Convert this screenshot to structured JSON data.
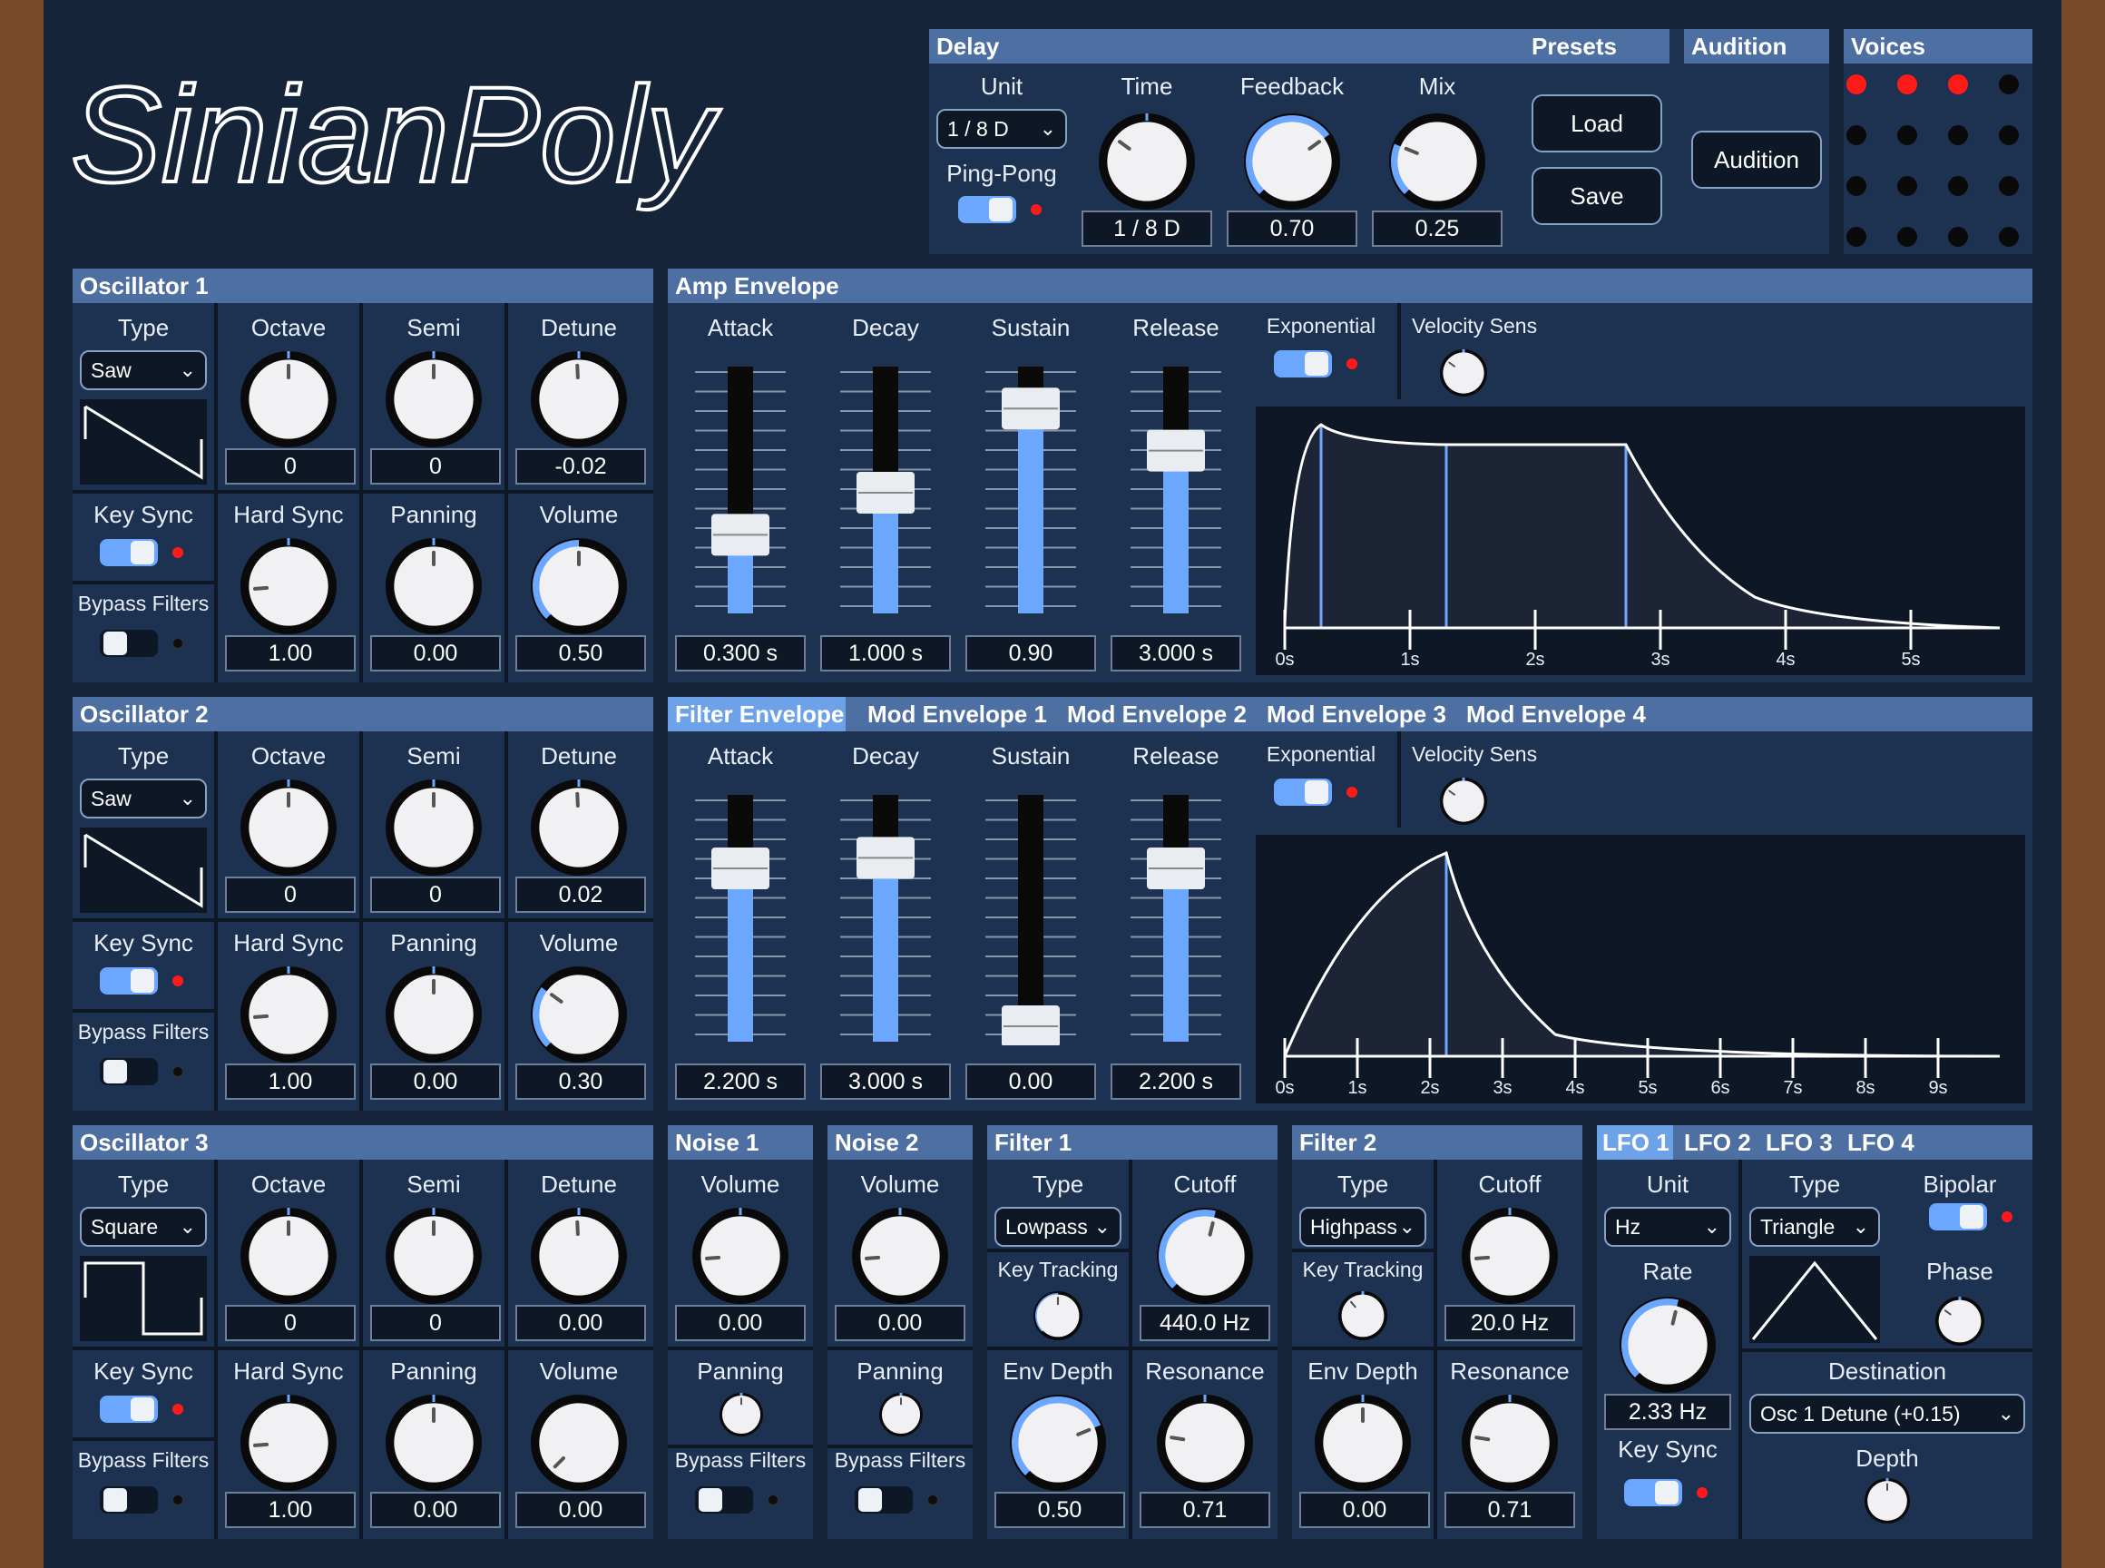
{
  "app": {
    "logo_text": "SinianPoly"
  },
  "delay": {
    "title": "Delay",
    "unit_label": "Unit",
    "unit_value": "1 / 8 D",
    "pingpong_label": "Ping-Pong",
    "pingpong_on": true,
    "time_label": "Time",
    "time_value": "1 / 8 D",
    "feedback_label": "Feedback",
    "feedback_value": "0.70",
    "mix_label": "Mix",
    "mix_value": "0.25"
  },
  "presets": {
    "title": "Presets",
    "load_label": "Load",
    "save_label": "Save"
  },
  "audition": {
    "title": "Audition",
    "button_label": "Audition"
  },
  "voices": {
    "title": "Voices",
    "active": [
      true,
      true,
      true,
      false,
      false,
      false,
      false,
      false,
      false,
      false,
      false,
      false,
      false,
      false,
      false,
      false
    ]
  },
  "oscillators": [
    {
      "title": "Oscillator 1",
      "type_label": "Type",
      "type_value": "Saw",
      "wave": "saw",
      "octave_label": "Octave",
      "octave_value": "0",
      "semi_label": "Semi",
      "semi_value": "0",
      "detune_label": "Detune",
      "detune_value": "-0.02",
      "keysync_label": "Key Sync",
      "keysync_on": true,
      "bypass_label": "Bypass Filters",
      "bypass_on": false,
      "hardsync_label": "Hard Sync",
      "hardsync_value": "1.00",
      "panning_label": "Panning",
      "panning_value": "0.00",
      "volume_label": "Volume",
      "volume_value": "0.50"
    },
    {
      "title": "Oscillator 2",
      "type_label": "Type",
      "type_value": "Saw",
      "wave": "saw",
      "octave_label": "Octave",
      "octave_value": "0",
      "semi_label": "Semi",
      "semi_value": "0",
      "detune_label": "Detune",
      "detune_value": "0.02",
      "keysync_label": "Key Sync",
      "keysync_on": true,
      "bypass_label": "Bypass Filters",
      "bypass_on": false,
      "hardsync_label": "Hard Sync",
      "hardsync_value": "1.00",
      "panning_label": "Panning",
      "panning_value": "0.00",
      "volume_label": "Volume",
      "volume_value": "0.30"
    },
    {
      "title": "Oscillator 3",
      "type_label": "Type",
      "type_value": "Square",
      "wave": "square",
      "octave_label": "Octave",
      "octave_value": "0",
      "semi_label": "Semi",
      "semi_value": "0",
      "detune_label": "Detune",
      "detune_value": "0.00",
      "keysync_label": "Key Sync",
      "keysync_on": true,
      "bypass_label": "Bypass Filters",
      "bypass_on": false,
      "hardsync_label": "Hard Sync",
      "hardsync_value": "1.00",
      "panning_label": "Panning",
      "panning_value": "0.00",
      "volume_label": "Volume",
      "volume_value": "0.00"
    }
  ],
  "amp_env": {
    "title": "Amp Envelope",
    "attack_label": "Attack",
    "attack_value": "0.300 s",
    "attack_level": 0.3,
    "decay_label": "Decay",
    "decay_value": "1.000 s",
    "decay_level": 0.5,
    "sustain_label": "Sustain",
    "sustain_value": "0.90",
    "sustain_level": 0.9,
    "release_label": "Release",
    "release_value": "3.000 s",
    "release_level": 0.7,
    "exponential_label": "Exponential",
    "exponential_on": true,
    "velocity_label": "Velocity Sens",
    "ticks": [
      "0s",
      "1s",
      "2s",
      "3s",
      "4s",
      "5s"
    ]
  },
  "filter_env": {
    "tabs": [
      "Filter Envelope",
      "Mod Envelope 1",
      "Mod Envelope 2",
      "Mod Envelope 3",
      "Mod Envelope 4"
    ],
    "attack_label": "Attack",
    "attack_value": "2.200 s",
    "attack_level": 0.75,
    "decay_label": "Decay",
    "decay_value": "3.000 s",
    "decay_level": 0.8,
    "sustain_label": "Sustain",
    "sustain_value": "0.00",
    "sustain_level": 0.0,
    "release_label": "Release",
    "release_value": "2.200 s",
    "release_level": 0.75,
    "exponential_label": "Exponential",
    "exponential_on": true,
    "velocity_label": "Velocity Sens",
    "ticks": [
      "0s",
      "1s",
      "2s",
      "3s",
      "4s",
      "5s",
      "6s",
      "7s",
      "8s",
      "9s"
    ]
  },
  "noise": [
    {
      "title": "Noise 1",
      "volume_label": "Volume",
      "volume_value": "0.00",
      "panning_label": "Panning",
      "bypass_label": "Bypass Filters",
      "bypass_on": false
    },
    {
      "title": "Noise 2",
      "volume_label": "Volume",
      "volume_value": "0.00",
      "panning_label": "Panning",
      "bypass_label": "Bypass Filters",
      "bypass_on": false
    }
  ],
  "filters": [
    {
      "title": "Filter 1",
      "type_label": "Type",
      "type_value": "Lowpass",
      "cutoff_label": "Cutoff",
      "cutoff_value": "440.0 Hz",
      "keytrack_label": "Key Tracking",
      "envdepth_label": "Env Depth",
      "envdepth_value": "0.50",
      "resonance_label": "Resonance",
      "resonance_value": "0.71"
    },
    {
      "title": "Filter 2",
      "type_label": "Type",
      "type_value": "Highpass",
      "cutoff_label": "Cutoff",
      "cutoff_value": "20.0 Hz",
      "keytrack_label": "Key Tracking",
      "envdepth_label": "Env Depth",
      "envdepth_value": "0.00",
      "resonance_label": "Resonance",
      "resonance_value": "0.71"
    }
  ],
  "lfo": {
    "tabs": [
      "LFO 1",
      "LFO 2",
      "LFO 3",
      "LFO 4"
    ],
    "unit_label": "Unit",
    "unit_value": "Hz",
    "type_label": "Type",
    "type_value": "Triangle",
    "bipolar_label": "Bipolar",
    "bipolar_on": true,
    "rate_label": "Rate",
    "rate_value": "2.33 Hz",
    "phase_label": "Phase",
    "destination_label": "Destination",
    "destination_value": "Osc 1 Detune (+0.15)",
    "keysync_label": "Key Sync",
    "keysync_on": true,
    "depth_label": "Depth"
  },
  "colors": {
    "accent": "#6ba6ff",
    "header": "#4e6fa2",
    "panel": "#1d3150",
    "background": "#16243a",
    "led": "#ff1a1a"
  }
}
